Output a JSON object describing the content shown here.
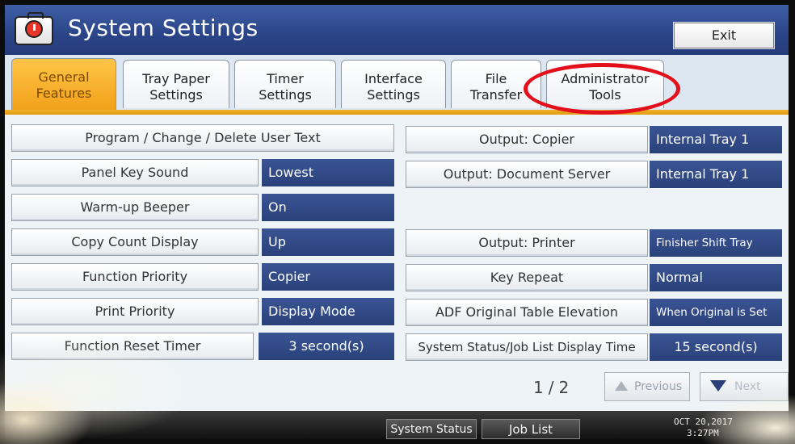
{
  "header": {
    "title": "System Settings",
    "exit_label": "Exit"
  },
  "tabs": [
    {
      "line1": "General",
      "line2": "Features",
      "active": true
    },
    {
      "line1": "Tray Paper",
      "line2": "Settings",
      "active": false
    },
    {
      "line1": "Timer",
      "line2": "Settings",
      "active": false
    },
    {
      "line1": "Interface",
      "line2": "Settings",
      "active": false
    },
    {
      "line1": "File",
      "line2": "Transfer",
      "active": false
    },
    {
      "line1": "Administrator",
      "line2": "Tools",
      "active": false
    }
  ],
  "left_settings": [
    {
      "label": "Program / Change / Delete User Text",
      "value": ""
    },
    {
      "label": "Panel Key Sound",
      "value": "Lowest"
    },
    {
      "label": "Warm-up Beeper",
      "value": "On"
    },
    {
      "label": "Copy Count Display",
      "value": "Up"
    },
    {
      "label": "Function Priority",
      "value": "Copier"
    },
    {
      "label": "Print Priority",
      "value": "Display Mode"
    },
    {
      "label": "Function Reset Timer",
      "value": "3 second(s)"
    }
  ],
  "right_settings": [
    {
      "label": "Output: Copier",
      "value": "Internal Tray 1"
    },
    {
      "label": "Output: Document Server",
      "value": "Internal Tray 1"
    },
    {
      "label": "Output: Printer",
      "value": "Finisher Shift Tray"
    },
    {
      "label": "Key Repeat",
      "value": "Normal"
    },
    {
      "label": "ADF Original Table Elevation",
      "value": "When Original is Set"
    },
    {
      "label": "System Status/Job List Display Time",
      "value": "15 second(s)"
    }
  ],
  "pagination": {
    "indicator": "1/2",
    "previous_label": "Previous",
    "next_label": "Next"
  },
  "statusbar": {
    "system_status_label": "System Status",
    "job_list_label": "Job List",
    "date": "OCT  20,2017",
    "time": "3:27PM"
  },
  "colors": {
    "title_bar": "#2b4488",
    "active_tab": "#f2a11a",
    "value_box": "#2a417a",
    "highlight_ring": "#e3101c"
  }
}
